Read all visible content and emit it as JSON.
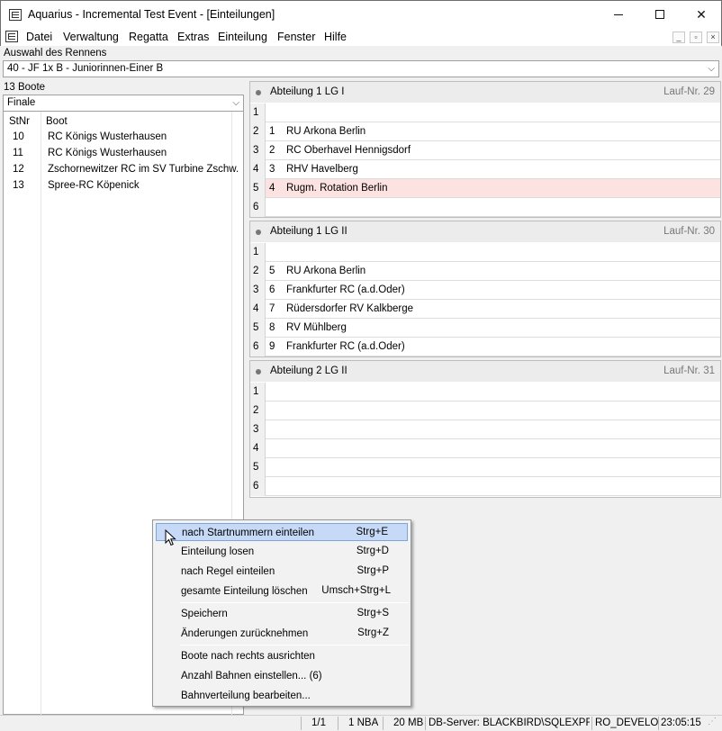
{
  "window": {
    "title": "Aquarius - Incremental Test Event - [Einteilungen]",
    "controls": {
      "minimize": "—",
      "maximize": "□",
      "close": "✕"
    }
  },
  "menu": {
    "items": [
      "Datei",
      "Verwaltung",
      "Regatta",
      "Extras",
      "Einteilung",
      "Fenster",
      "Hilfe"
    ],
    "mdi_controls": [
      "_",
      "▫",
      "×"
    ]
  },
  "rennen": {
    "label": "Auswahl des Rennens",
    "selected": "40 - JF 1x B - Juniorinnen-Einer B"
  },
  "left": {
    "count": "13 Boote",
    "filter": "Finale",
    "headers": {
      "stnr": "StNr",
      "boot": "Boot"
    },
    "rows": [
      {
        "stnr": "10",
        "boot": "RC Königs Wusterhausen"
      },
      {
        "stnr": "11",
        "boot": "RC Königs Wusterhausen"
      },
      {
        "stnr": "12",
        "boot": "Zschornewitzer RC im SV Turbine Zschw."
      },
      {
        "stnr": "13",
        "boot": "Spree-RC Köpenick"
      }
    ]
  },
  "heats": [
    {
      "title": "Abteilung 1 LG I",
      "lauf": "Lauf-Nr. 29",
      "lanes": [
        {
          "lane": "1",
          "stnr": "",
          "boot": ""
        },
        {
          "lane": "2",
          "stnr": "1",
          "boot": "RU Arkona Berlin"
        },
        {
          "lane": "3",
          "stnr": "2",
          "boot": "RC Oberhavel Hennigsdorf"
        },
        {
          "lane": "4",
          "stnr": "3",
          "boot": "RHV Havelberg"
        },
        {
          "lane": "5",
          "stnr": "4",
          "boot": "Rugm. Rotation Berlin",
          "highlight": true
        },
        {
          "lane": "6",
          "stnr": "",
          "boot": ""
        }
      ]
    },
    {
      "title": "Abteilung 1 LG II",
      "lauf": "Lauf-Nr. 30",
      "lanes": [
        {
          "lane": "1",
          "stnr": "",
          "boot": ""
        },
        {
          "lane": "2",
          "stnr": "5",
          "boot": "RU Arkona Berlin"
        },
        {
          "lane": "3",
          "stnr": "6",
          "boot": "Frankfurter RC (a.d.Oder)"
        },
        {
          "lane": "4",
          "stnr": "7",
          "boot": "Rüdersdorfer RV Kalkberge"
        },
        {
          "lane": "5",
          "stnr": "8",
          "boot": "RV  Mühlberg"
        },
        {
          "lane": "6",
          "stnr": "9",
          "boot": "Frankfurter RC (a.d.Oder)"
        }
      ]
    },
    {
      "title": "Abteilung 2 LG II",
      "lauf": "Lauf-Nr. 31",
      "lanes": [
        {
          "lane": "1",
          "stnr": "",
          "boot": ""
        },
        {
          "lane": "2",
          "stnr": "",
          "boot": ""
        },
        {
          "lane": "3",
          "stnr": "",
          "boot": ""
        },
        {
          "lane": "4",
          "stnr": "",
          "boot": ""
        },
        {
          "lane": "5",
          "stnr": "",
          "boot": ""
        },
        {
          "lane": "6",
          "stnr": "",
          "boot": ""
        }
      ]
    }
  ],
  "context_menu": {
    "items": [
      {
        "label": "nach Startnummern einteilen",
        "shortcut": "Strg+E"
      },
      {
        "label": "Einteilung losen",
        "shortcut": "Strg+D"
      },
      {
        "label": "nach Regel einteilen",
        "shortcut": "Strg+P"
      },
      {
        "label": "gesamte Einteilung löschen",
        "shortcut": "Umsch+Strg+L"
      },
      {
        "label": "Speichern",
        "shortcut": "Strg+S"
      },
      {
        "label": "Änderungen zurücknehmen",
        "shortcut": "Strg+Z"
      },
      {
        "label": "Boote nach rechts ausrichten",
        "shortcut": ""
      },
      {
        "label": "Anzahl Bahnen einstellen... (6)",
        "shortcut": ""
      },
      {
        "label": "Bahnverteilung bearbeiten...",
        "shortcut": ""
      }
    ]
  },
  "status": {
    "page": "1/1",
    "nba": "1 NBA",
    "memory": "20 MB",
    "db": "DB-Server: BLACKBIRD\\SQLEXPRESS",
    "user": "RO_DEVELOP",
    "time": "23:05:15"
  },
  "colors": {
    "highlight_row": "#fde2e2",
    "menu_selection": "#c6daf7"
  }
}
